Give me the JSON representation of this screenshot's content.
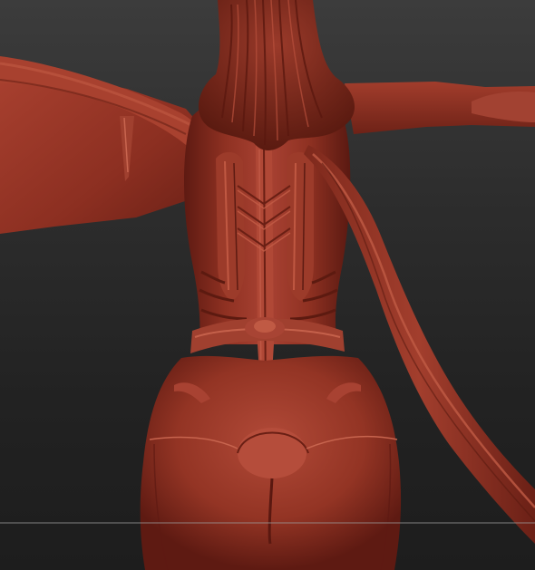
{
  "viewport": {
    "background_top": "#3c3c3c",
    "background_bottom": "#1d1d1d",
    "model_color": "#8e3124",
    "floor_line_color": "#9a9a9a"
  }
}
